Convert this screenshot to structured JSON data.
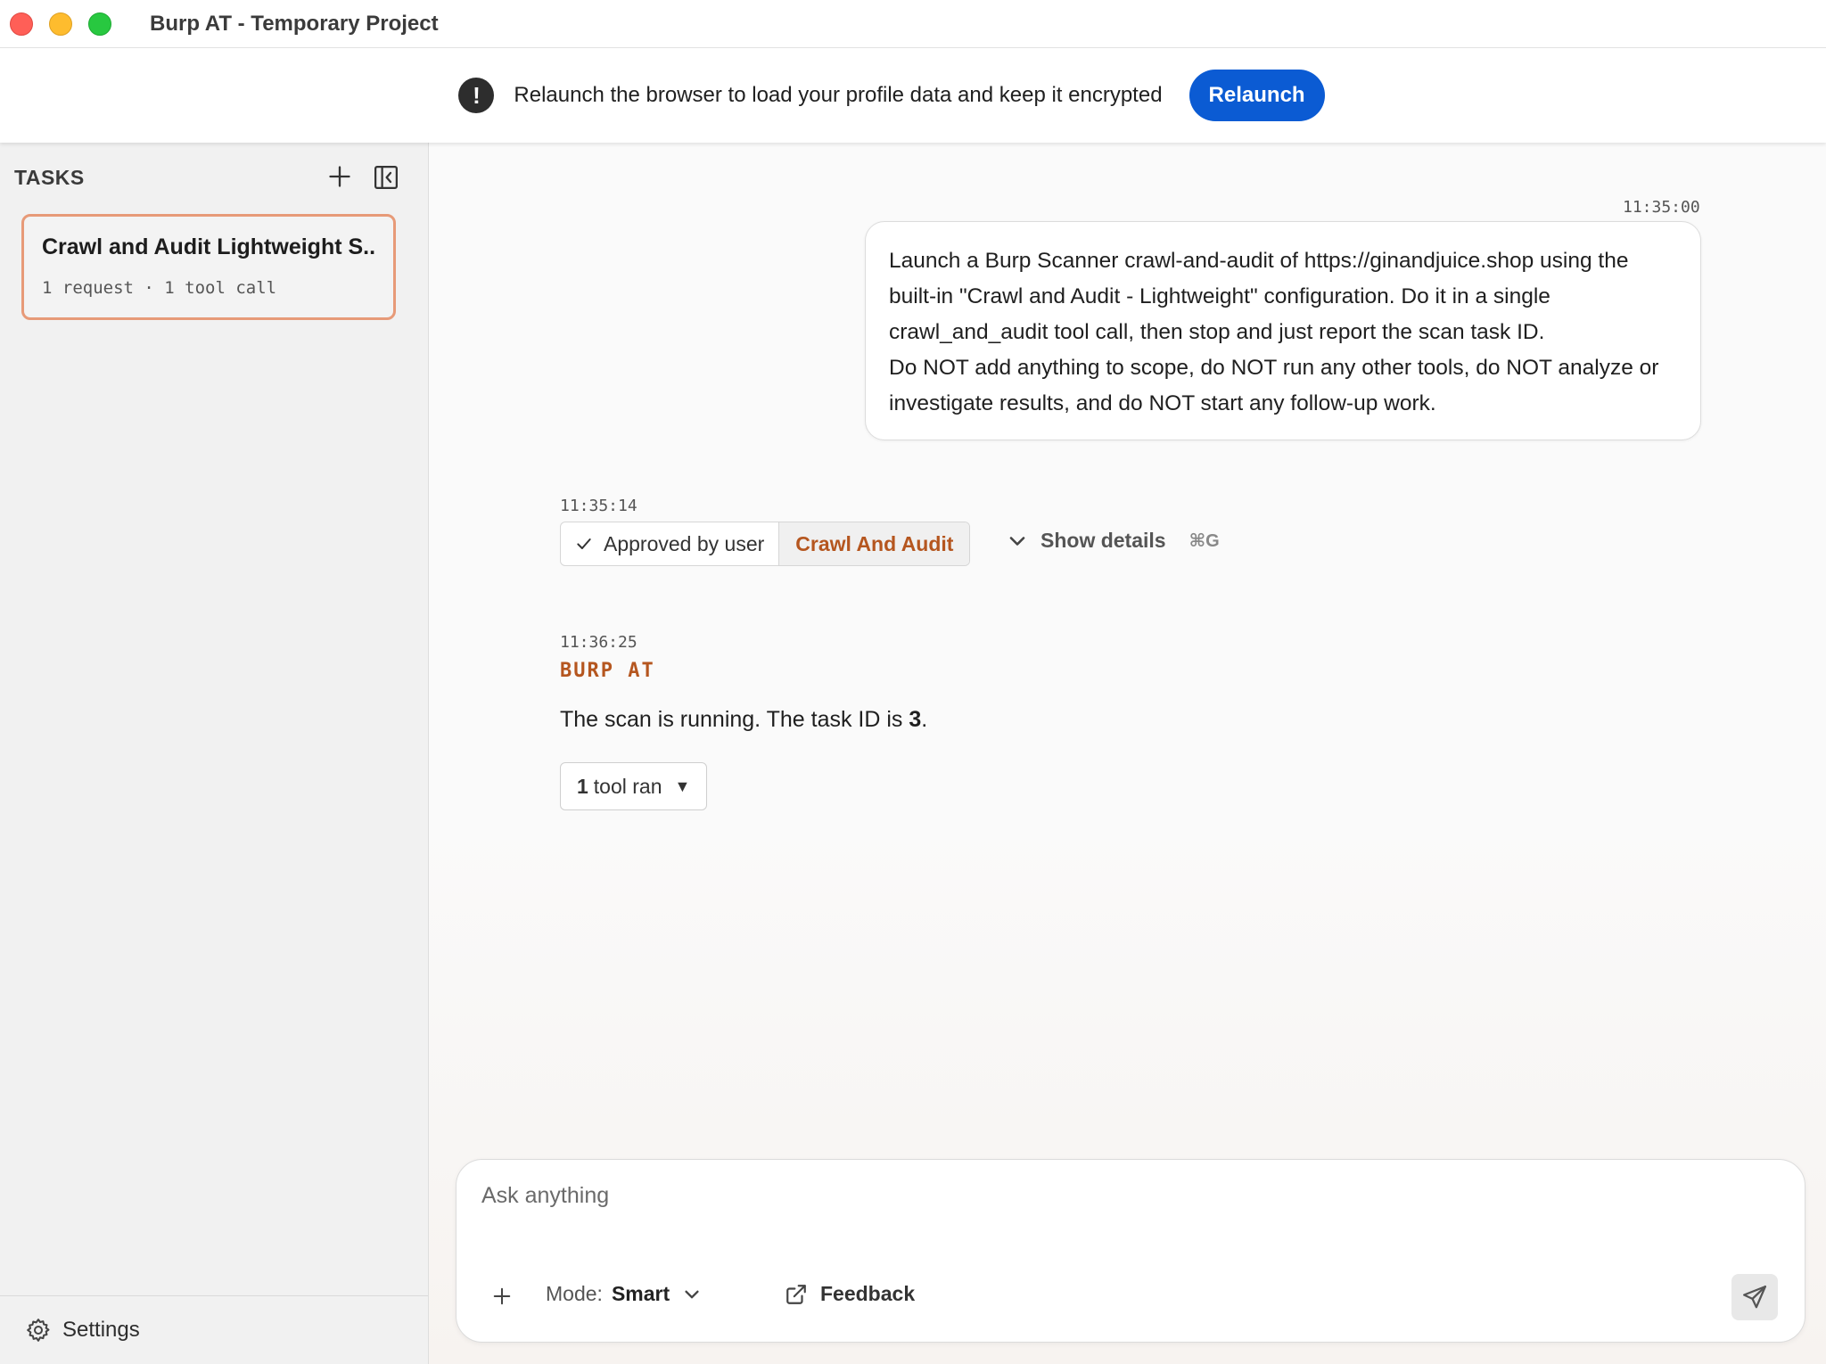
{
  "window": {
    "title": "Burp AT - Temporary Project"
  },
  "banner": {
    "message": "Relaunch the browser to load your profile data and keep it encrypted",
    "button_label": "Relaunch",
    "icon": "exclamation-icon"
  },
  "sidebar": {
    "header": "TASKS",
    "tasks": [
      {
        "title": "Crawl and Audit Lightweight S...",
        "meta": "1 request · 1 tool call"
      }
    ],
    "settings_label": "Settings"
  },
  "conversation": {
    "user_message": {
      "timestamp": "11:35:00",
      "lines": [
        "Launch a Burp Scanner crawl-and-audit of https://ginandjuice.shop using the",
        "built-in \"Crawl and Audit - Lightweight\" configuration. Do it in a single",
        "crawl_and_audit tool call, then stop and just report the scan task ID.",
        "Do NOT add anything to scope, do NOT run any other tools, do NOT analyze or",
        "investigate results, and do NOT start any follow-up work."
      ]
    },
    "tool_call": {
      "timestamp": "11:35:14",
      "approval_label": "Approved by user",
      "tool_name": "Crawl And Audit",
      "show_details_label": "Show details",
      "shortcut": "⌘G"
    },
    "agent_reply": {
      "timestamp": "11:36:25",
      "agent_name": "BURP AT",
      "text_before": "The scan is running. The task ID is ",
      "task_id": "3",
      "text_after": ".",
      "tools_count": "1",
      "tools_label": "tool ran"
    }
  },
  "composer": {
    "placeholder": "Ask anything",
    "mode_label": "Mode:",
    "mode_value": "Smart",
    "feedback_label": "Feedback"
  },
  "colors": {
    "accent_blue": "#0b5bd3",
    "brand_orange": "#b5561f",
    "task_card_border": "#e79a78"
  }
}
